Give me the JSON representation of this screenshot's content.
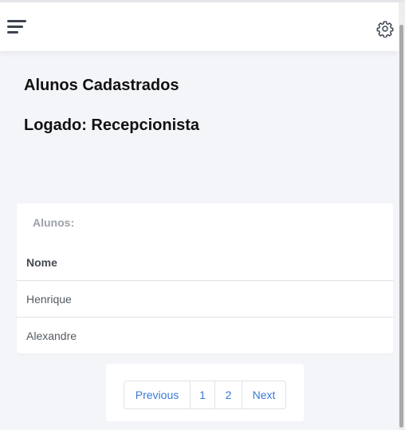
{
  "header": {
    "menu_icon": "hamburger-menu-icon",
    "settings_icon": "gear-icon"
  },
  "page": {
    "title": "Alunos Cadastrados",
    "logged_user": "Logado: Recepcionista"
  },
  "card": {
    "title": "Alunos:",
    "columns": [
      "Nome"
    ],
    "rows": [
      [
        "Henrique"
      ],
      [
        "Alexandre"
      ]
    ]
  },
  "pagination": {
    "previous": "Previous",
    "pages": [
      "1",
      "2"
    ],
    "next": "Next"
  },
  "colors": {
    "background": "#f4f5f9",
    "link": "#3a78d8",
    "heading": "#111111"
  }
}
